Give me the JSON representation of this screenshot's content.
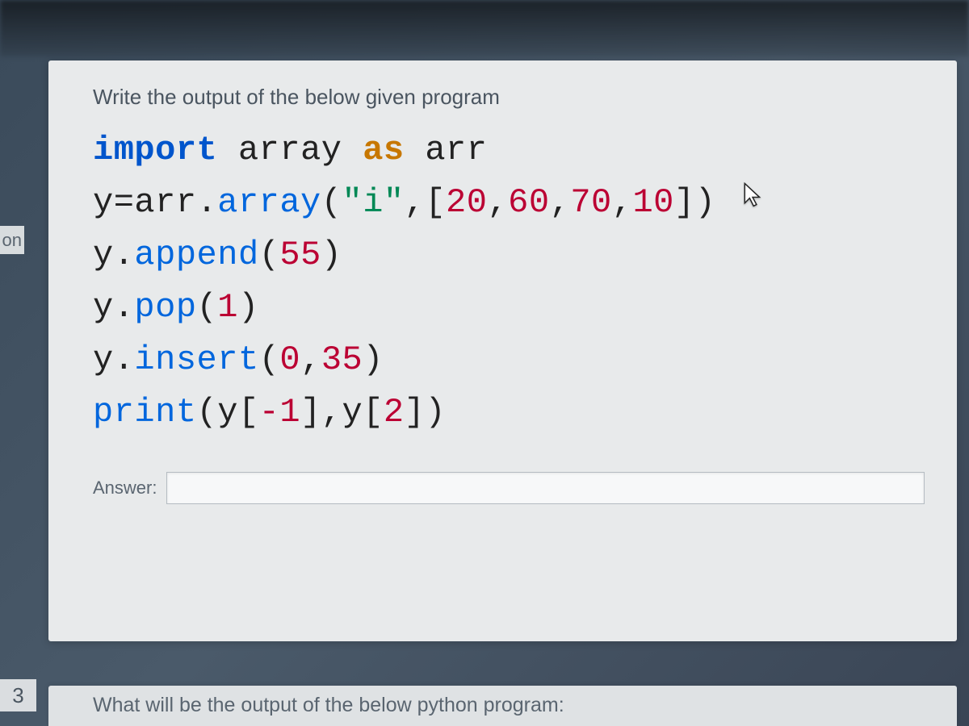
{
  "question": {
    "prompt": "Write the output of the below given program",
    "code": {
      "line1": {
        "import": "import",
        "array_mod": "array",
        "as_kw": "as",
        "alias": "arr"
      },
      "line2": {
        "var": "y=arr.",
        "fn": "array",
        "open": "(",
        "str": "\"i\"",
        "comma": ",[",
        "n1": "20",
        "c1": ",",
        "n2": "60",
        "c2": ",",
        "n3": "70",
        "c3": ",",
        "n4": "10",
        "close": "])"
      },
      "line3": {
        "pre": "y.",
        "fn": "append",
        "open": "(",
        "n": "55",
        "close": ")"
      },
      "line4": {
        "pre": "y.",
        "fn": "pop",
        "open": "(",
        "n": "1",
        "close": ")"
      },
      "line5": {
        "pre": "y.",
        "fn": "insert",
        "open": "(",
        "n1": "0",
        "c": ",",
        "n2": "35",
        "close": ")"
      },
      "line6": {
        "fn": "print",
        "open": "(y[",
        "n1": "-1",
        "mid": "],y[",
        "n2": "2",
        "close": "])"
      }
    },
    "answer_label": "Answer:",
    "answer_value": ""
  },
  "left_fragments": {
    "f1": "on",
    "f2": "3"
  },
  "next_question_partial": "What will be the output of the below python program:"
}
